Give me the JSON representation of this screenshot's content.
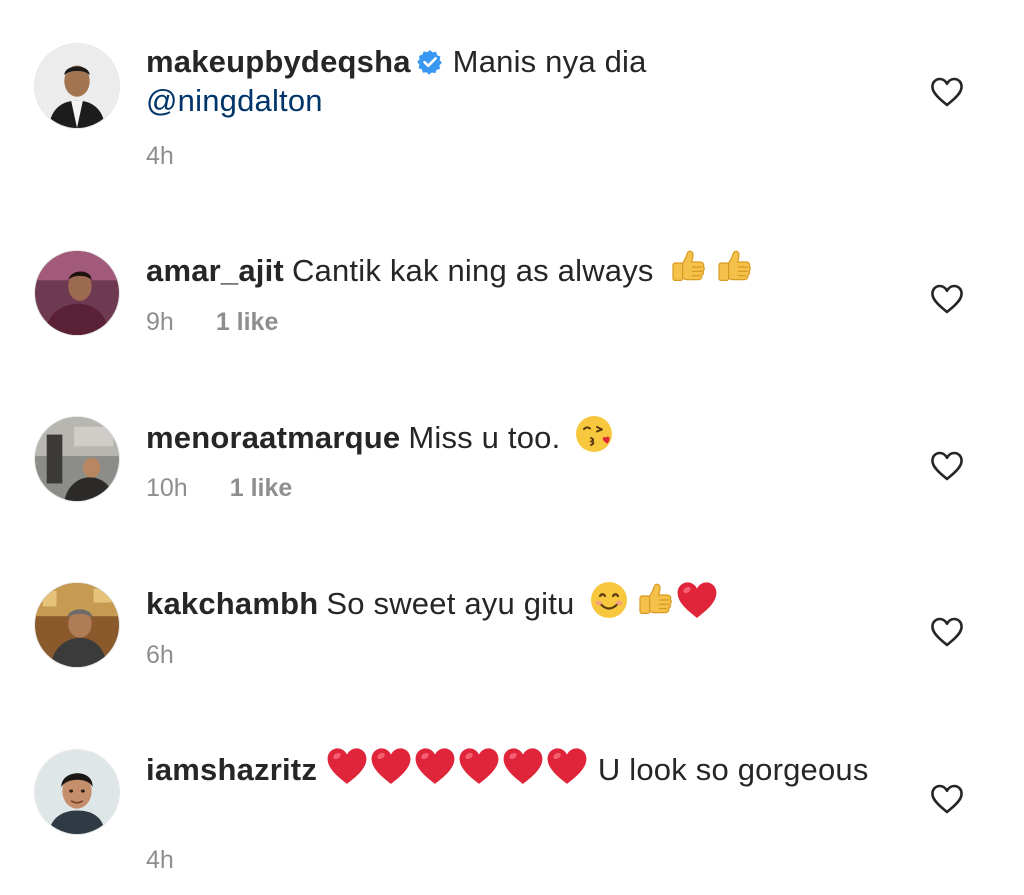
{
  "comments": [
    {
      "username": "makeupbydeqsha",
      "verified": true,
      "text": "Manis nya dia",
      "mention": "@ningdalton",
      "time": "4h",
      "likes": "",
      "emojis": []
    },
    {
      "username": "amar_ajit",
      "verified": false,
      "text": "Cantik kak ning as always",
      "time": "9h",
      "likes": "1 like",
      "emojis": [
        "thumbs-up",
        "thumbs-up"
      ]
    },
    {
      "username": "menoraatmarque",
      "verified": false,
      "text": "Miss u too.",
      "time": "10h",
      "likes": "1 like",
      "emojis": [
        "kissing-face"
      ]
    },
    {
      "username": "kakchambh",
      "verified": false,
      "text": "So sweet ayu gitu",
      "time": "6h",
      "likes": "",
      "emojis": [
        "smiling-face",
        "thumbs-up",
        "red-heart"
      ]
    },
    {
      "username": "iamshazritz",
      "verified": false,
      "text_after": "U look so gorgeous",
      "time": "4h",
      "likes": "",
      "emojis": [
        "red-heart",
        "red-heart",
        "red-heart",
        "red-heart",
        "red-heart",
        "red-heart"
      ]
    }
  ],
  "icons": {
    "like": "heart-outline-icon",
    "verified": "verified-badge-icon"
  },
  "colors": {
    "username": "#262626",
    "mention": "#003569",
    "meta": "#8e8e8e",
    "verified": "#3897f0",
    "heart_emoji": "#e0243a"
  }
}
